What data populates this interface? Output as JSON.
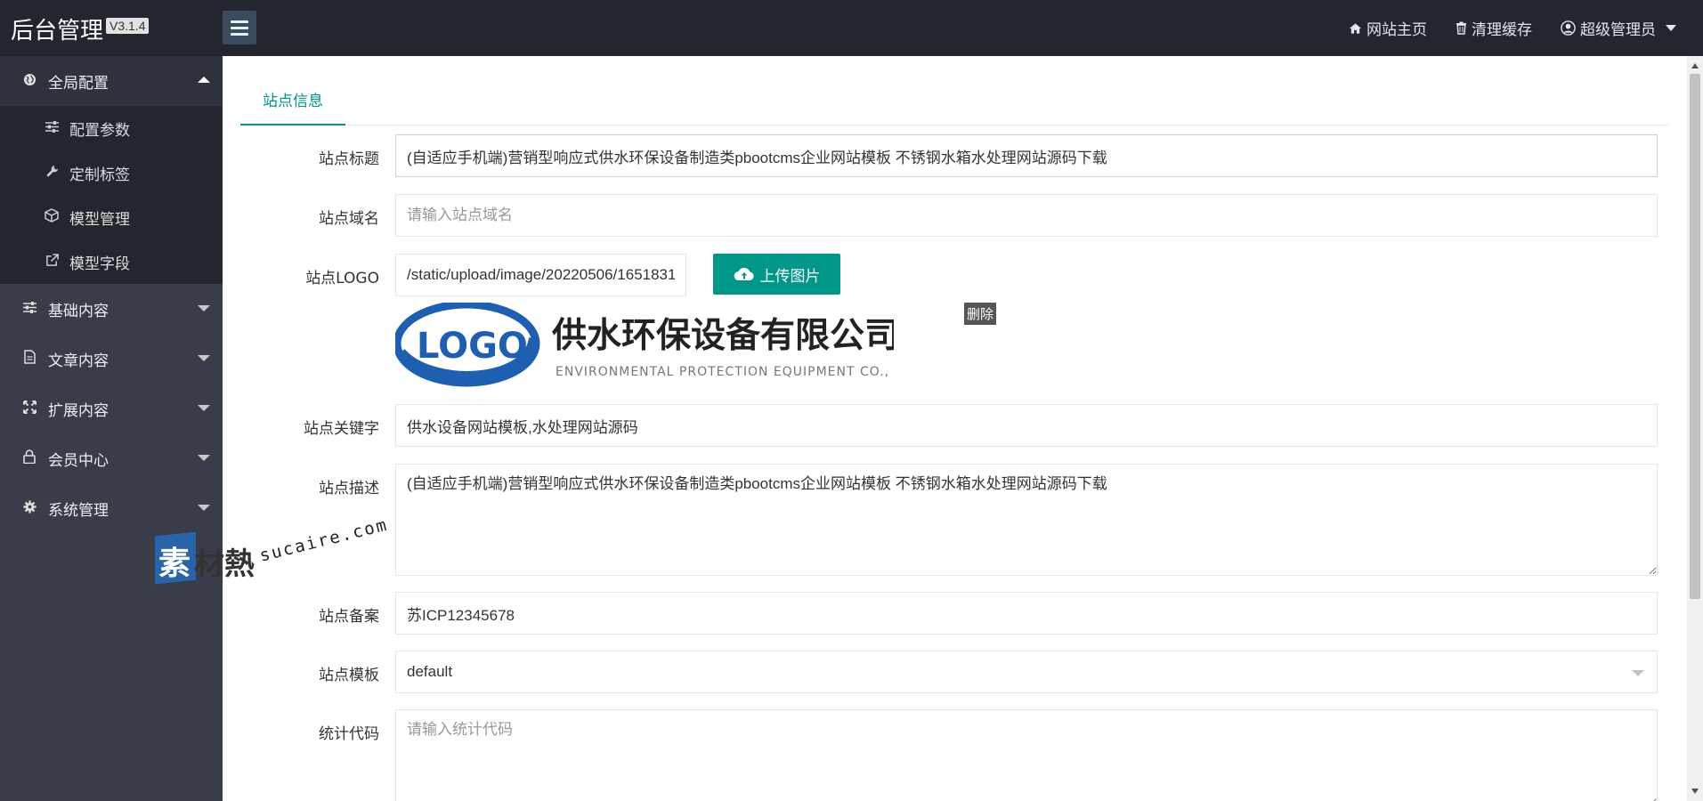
{
  "header": {
    "brand": "后台管理",
    "version": "V3.1.4",
    "links": {
      "home": "网站主页",
      "clear_cache": "清理缓存",
      "user": "超级管理员"
    }
  },
  "sidebar": {
    "global_config": {
      "label": "全局配置",
      "items": [
        "配置参数",
        "定制标签",
        "模型管理",
        "模型字段"
      ]
    },
    "groups": [
      "基础内容",
      "文章内容",
      "扩展内容",
      "会员中心",
      "系统管理"
    ]
  },
  "watermark": {
    "char1": "素",
    "char2": "材熱",
    "domain": "sucaire.com"
  },
  "tabs": {
    "active": "站点信息"
  },
  "form": {
    "title": {
      "label": "站点标题",
      "value": "(自适应手机端)营销型响应式供水环保设备制造类pbootcms企业网站模板 不锈钢水箱水处理网站源码下载"
    },
    "domain": {
      "label": "站点域名",
      "placeholder": "请输入站点域名"
    },
    "logo": {
      "label": "站点LOGO",
      "value": "/static/upload/image/20220506/1651831",
      "upload_label": "上传图片",
      "delete_label": "删除",
      "preview": {
        "mark": "LOGO",
        "company": "供水环保设备有限公司",
        "company_en": "ENVIRONMENTAL PROTECTION EQUIPMENT CO., LTD."
      }
    },
    "keywords": {
      "label": "站点关键字",
      "value": "供水设备网站模板,水处理网站源码"
    },
    "description": {
      "label": "站点描述",
      "value": "(自适应手机端)营销型响应式供水环保设备制造类pbootcms企业网站模板 不锈钢水箱水处理网站源码下载"
    },
    "icp": {
      "label": "站点备案",
      "value": "苏ICP12345678"
    },
    "template": {
      "label": "站点模板",
      "value": "default"
    },
    "stats": {
      "label": "统计代码",
      "placeholder": "请输入统计代码"
    }
  },
  "colors": {
    "topbar": "#23262e",
    "sidebar": "#393d49",
    "accent": "#009688",
    "logo_blue": "#1f5fb0",
    "logo_red": "#e0322b"
  },
  "icons": {
    "home": "home-icon",
    "trash": "trash-icon",
    "user": "user-circle-icon",
    "globe": "globe-icon",
    "sliders": "sliders-icon",
    "wrench": "wrench-icon",
    "cube": "cube-icon",
    "external": "external-link-icon",
    "file": "file-icon",
    "expand": "expand-icon",
    "lock": "lock-icon",
    "gear": "gear-icon",
    "cloud_upload": "cloud-upload-icon"
  }
}
